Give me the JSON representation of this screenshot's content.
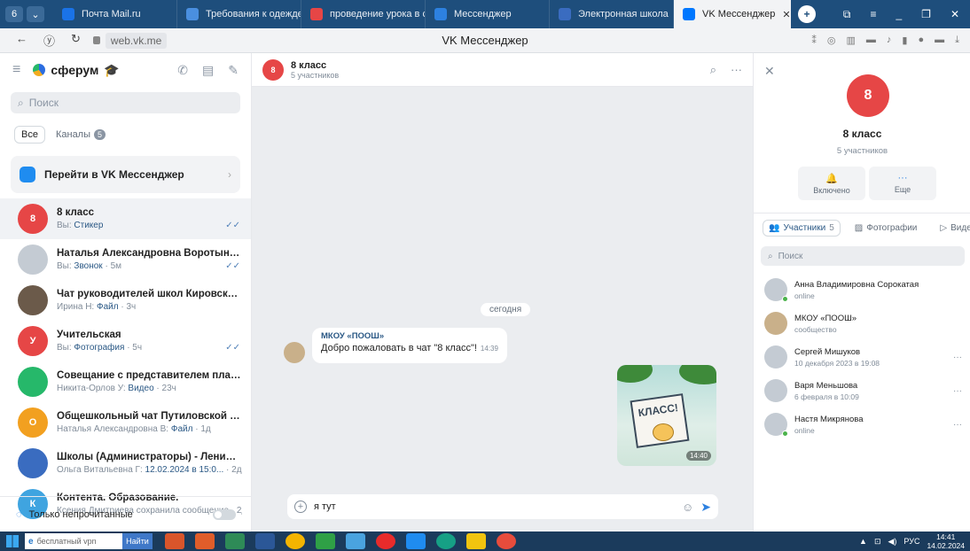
{
  "browser": {
    "tabs": [
      {
        "label": "Почта Mail.ru",
        "color": "#1a73e8"
      },
      {
        "label": "Требования к одежде обу",
        "color": "#4a8fe0"
      },
      {
        "label": "проведение урока в сфер",
        "color": "#e64646"
      },
      {
        "label": "Мессенджер",
        "color": "#2d81e0"
      },
      {
        "label": "Электронная школа",
        "color": "#3a6cc0"
      },
      {
        "label": "VK Мессенджер",
        "color": "#0077ff",
        "active": true
      }
    ],
    "url": "web.vk.me",
    "page_title": "VK Мессенджер"
  },
  "sidebar": {
    "logo": "сферум",
    "search_placeholder": "Поиск",
    "filter_all": "Все",
    "filter_channels": "Каналы",
    "channels_count": "5",
    "promo_label": "Перейти в VK Мессенджер",
    "chats": [
      {
        "name": "8 класс",
        "sender": "Вы:",
        "preview": "Стикер",
        "time": "",
        "avatar_text": "8",
        "avatar_color": "#e64646",
        "selected": true,
        "read": true
      },
      {
        "name": "Наталья Александровна Воротынцева",
        "sender": "Вы:",
        "preview": "Звонок",
        "time": "· 5м",
        "avatar_text": "",
        "avatar_color": "#c4cbd3",
        "read": true
      },
      {
        "name": "Чат руководителей школ Кировского МР ...",
        "sender": "Ирина Н:",
        "preview": "Файл",
        "time": "· 3ч",
        "avatar_text": "",
        "avatar_color": "#6b5a4a"
      },
      {
        "name": "Учительская",
        "sender": "Вы:",
        "preview": "Фотография",
        "time": "· 5ч",
        "avatar_text": "У",
        "avatar_color": "#e64646",
        "read": true
      },
      {
        "name": "Совещание с представителем платформ...",
        "sender": "Никита-Орлов У:",
        "preview": "Видео",
        "time": "· 23ч",
        "avatar_text": "",
        "avatar_color": "#26b86a"
      },
      {
        "name": "Общешкольный чат Путиловской шко...",
        "sender": "Наталья Александровна В:",
        "preview": "Файл",
        "time": "· 1д",
        "avatar_text": "О",
        "avatar_color": "#f2a020"
      },
      {
        "name": "Школы (Администраторы) - Ленинградск...",
        "sender": "Ольга Витальевна Г:",
        "preview": "12.02.2024 в 15:0...",
        "time": "· 2д",
        "avatar_text": "",
        "avatar_color": "#3a6cc0"
      },
      {
        "name": "Контента. Образование.",
        "sender": "Ксения Дмитриева сохранила сообщение",
        "preview": "",
        "time": "· 2д",
        "avatar_text": "К",
        "avatar_color": "#3fa4e0"
      }
    ],
    "unread_only_label": "Только непрочитанные"
  },
  "chat": {
    "title": "8 класс",
    "subtitle": "5 участников",
    "avatar_text": "8",
    "date_separator": "сегодня",
    "message": {
      "sender": "МКОУ «ПООШ»",
      "text": "Добро пожаловать в чат \"8 класс\"!",
      "time": "14:39"
    },
    "sticker": {
      "text": "КЛАСС!",
      "time": "14:40"
    },
    "composer_value": "я тут"
  },
  "details": {
    "avatar_text": "8",
    "name": "8 класс",
    "subtitle": "5 участников",
    "action_notify": "Включено",
    "action_more": "Еще",
    "tabs": [
      {
        "label": "Участники",
        "count": "5"
      },
      {
        "label": "Фотографии",
        "count": ""
      },
      {
        "label": "Видео",
        "count": ""
      }
    ],
    "search_placeholder": "Поиск",
    "members": [
      {
        "name": "Анна Владимировна Сорокатая",
        "status": "online",
        "online": true
      },
      {
        "name": "МКОУ «ПООШ»",
        "status": "сообщество"
      },
      {
        "name": "Сергей Мишуков",
        "status": "10 декабря 2023 в 19:08",
        "more": true
      },
      {
        "name": "Варя Меньшова",
        "status": "6 февраля в 10:09",
        "more": true
      },
      {
        "name": "Настя Микрянова",
        "status": "online",
        "online": true,
        "more": true
      }
    ]
  },
  "taskbar": {
    "search_text": "бесплатный vpn",
    "find_label": "Найти",
    "lang": "РУС",
    "time": "14:41",
    "date": "14.02.2024"
  }
}
